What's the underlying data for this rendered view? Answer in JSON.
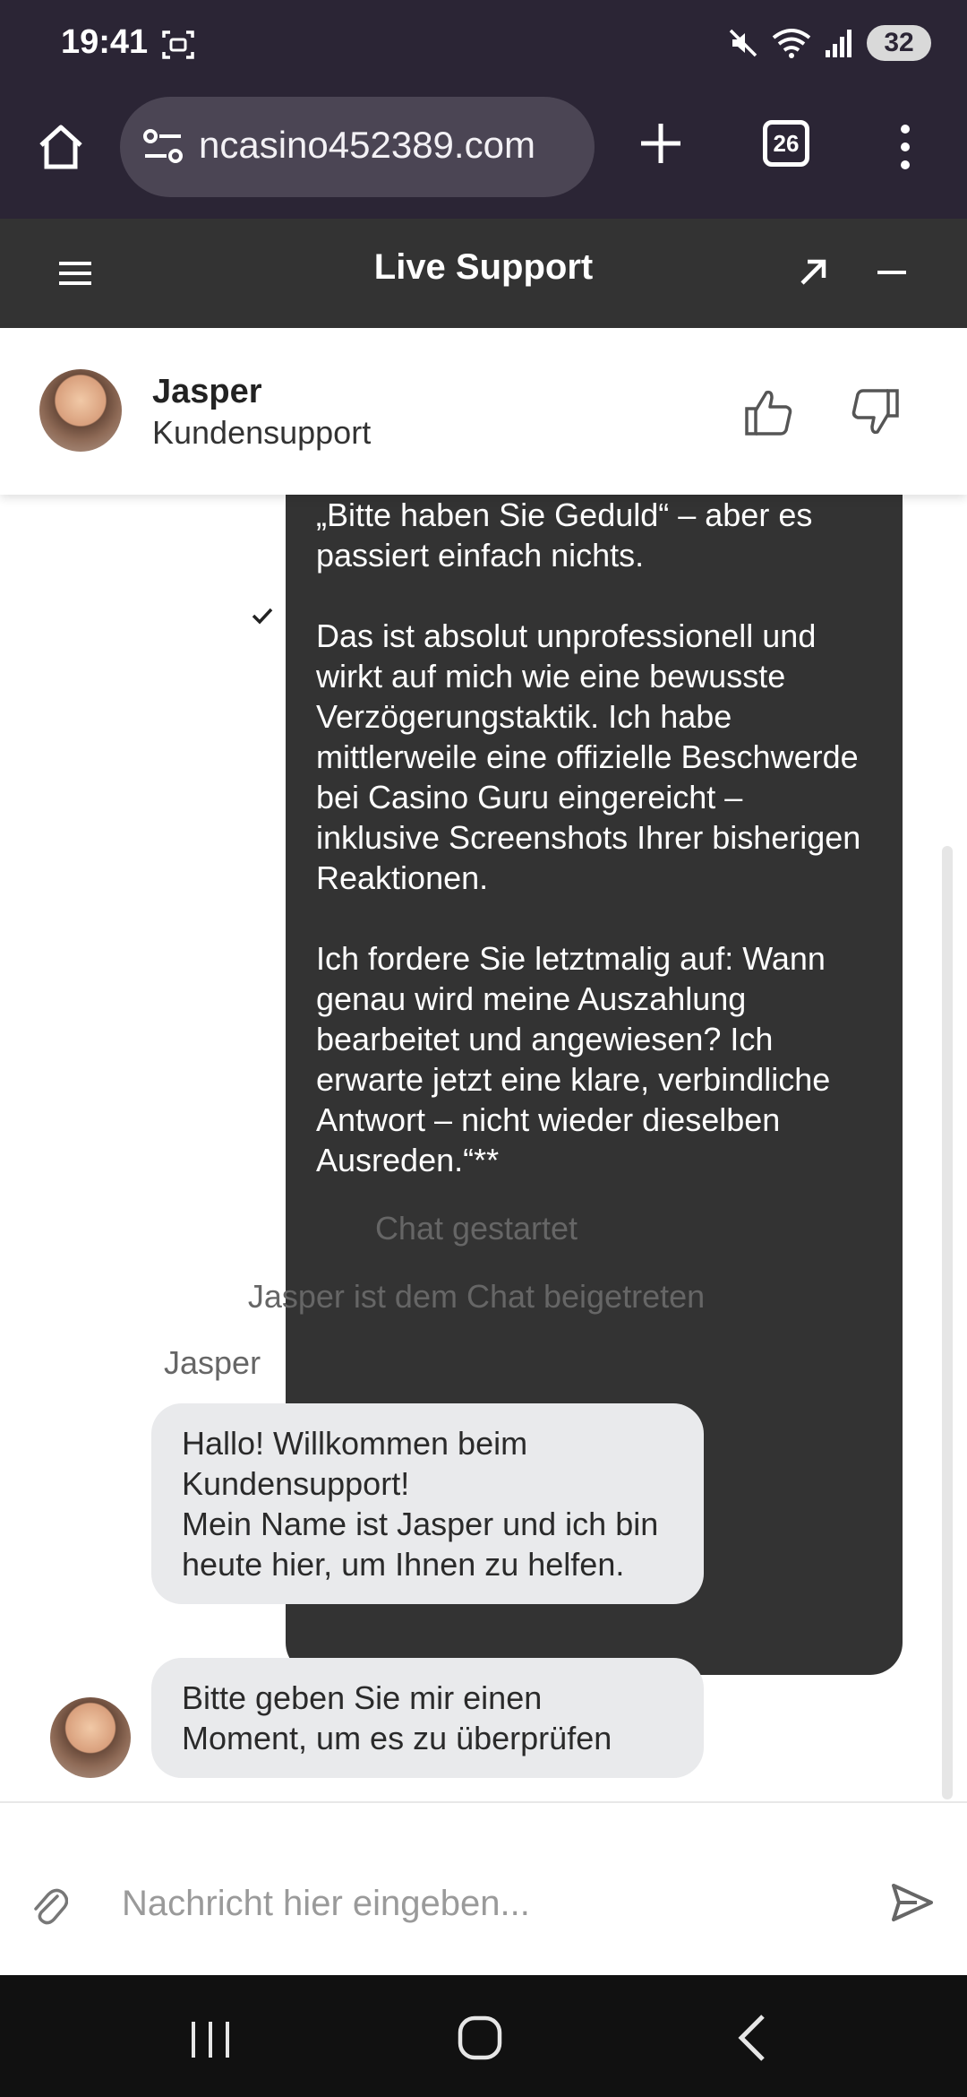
{
  "status_bar": {
    "time": "19:41",
    "battery": "32",
    "icons": [
      "screenshot-icon",
      "mute-icon",
      "wifi-icon",
      "signal-icon"
    ]
  },
  "browser": {
    "url": "ncasino452389.com",
    "tab_count": "26",
    "icons": [
      "home-icon",
      "site-settings-icon",
      "new-tab-icon",
      "tab-switcher-icon",
      "more-options-icon"
    ]
  },
  "chat_header": {
    "title": "Live Support"
  },
  "agent": {
    "name": "Jasper",
    "role": "Kundensupport"
  },
  "user_message": {
    "paragraphs": [
      "„Bitte haben Sie Geduld“ – aber es passiert einfach nichts.",
      "Das ist absolut unprofessionell und wirkt auf mich wie eine bewusste Verzögerungstaktik. Ich habe mittlerweile eine offizielle Beschwerde bei Casino Guru eingereicht – inklusive Screenshots Ihrer bisherigen Reaktionen.",
      "Ich fordere Sie letztmalig auf: Wann genau wird meine Auszahlung bearbeitet und angewiesen? Ich erwarte jetzt eine klare, verbindliche Antwort – nicht wieder dieselben Ausreden.“**"
    ]
  },
  "system_messages": {
    "chat_started": "Chat gestartet",
    "agent_joined": "Jasper ist dem Chat beigetreten"
  },
  "agent_messages": {
    "sender": "Jasper",
    "items": [
      "Hallo! Willkommen beim Kundensupport!\nMein Name ist Jasper und ich bin heute hier, um Ihnen zu helfen.",
      "Bitte geben Sie mir einen Moment, um es zu überprüfen"
    ]
  },
  "composer": {
    "placeholder": "Nachricht hier eingeben..."
  },
  "colors": {
    "browser_bg": "#2b2535",
    "header_bg": "#333333",
    "user_bubble": "#333333",
    "agent_bubble": "#e9eaec"
  }
}
